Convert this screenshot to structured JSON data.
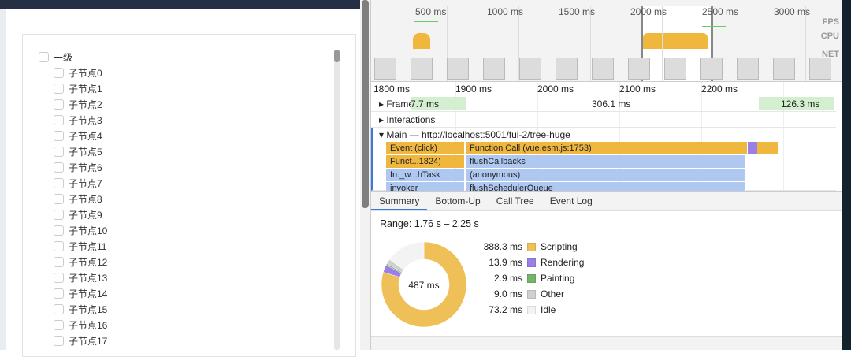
{
  "tree": {
    "root": "一级",
    "children": [
      "子节点0",
      "子节点1",
      "子节点2",
      "子节点3",
      "子节点4",
      "子节点5",
      "子节点6",
      "子节点7",
      "子节点8",
      "子节点9",
      "子节点10",
      "子节点11",
      "子节点12",
      "子节点13",
      "子节点14",
      "子节点15",
      "子节点16",
      "子节点17"
    ]
  },
  "overview": {
    "ticks": [
      "500 ms",
      "1000 ms",
      "1500 ms",
      "2000 ms",
      "2500 ms",
      "3000 ms"
    ],
    "labels": {
      "fps": "FPS",
      "cpu": "CPU",
      "net": "NET"
    }
  },
  "ruler": [
    "1800 ms",
    "1900 ms",
    "2000 ms",
    "2100 ms",
    "2200 ms"
  ],
  "tracks": {
    "frames": "Frames",
    "frame_values": [
      "7.7 ms",
      "306.1 ms",
      "126.3 ms"
    ],
    "interactions": "Interactions",
    "main": "Main — http://localhost:5001/fui-2/tree-huge"
  },
  "flame": [
    [
      "Event (click)",
      "Function Call (vue.esm.js:1753)"
    ],
    [
      "Funct...1824)",
      "flushCallbacks"
    ],
    [
      "fn._w...hTask",
      "(anonymous)"
    ],
    [
      "invoker",
      "flushSchedulerQueue"
    ]
  ],
  "tabs": [
    "Summary",
    "Bottom-Up",
    "Call Tree",
    "Event Log"
  ],
  "summary": {
    "range": "Range: 1.76 s – 2.25 s",
    "total": "487 ms",
    "items": [
      {
        "value": "388.3 ms",
        "label": "Scripting",
        "color": "#f0c058",
        "ms": 388.3
      },
      {
        "value": "13.9 ms",
        "label": "Rendering",
        "color": "#9a7fe6",
        "ms": 13.9
      },
      {
        "value": "2.9 ms",
        "label": "Painting",
        "color": "#72b564",
        "ms": 2.9
      },
      {
        "value": "9.0 ms",
        "label": "Other",
        "color": "#d0d0d0",
        "ms": 9.0
      },
      {
        "value": "73.2 ms",
        "label": "Idle",
        "color": "#f3f3f3",
        "ms": 73.2
      }
    ]
  }
}
